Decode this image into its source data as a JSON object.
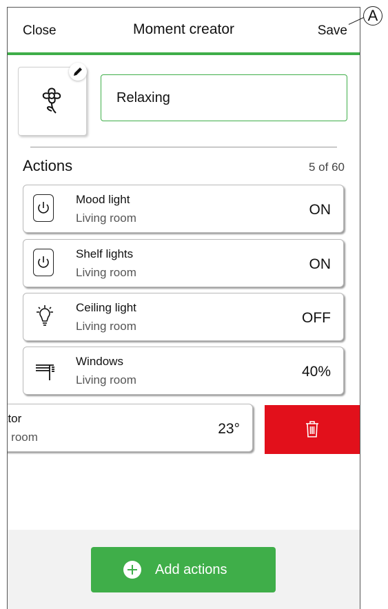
{
  "header": {
    "close_label": "Close",
    "title": "Moment creator",
    "save_label": "Save"
  },
  "callout": {
    "label": "A"
  },
  "moment": {
    "icon": "flower-icon",
    "name": "Relaxing"
  },
  "actions": {
    "title": "Actions",
    "count": "5 of 60",
    "items": [
      {
        "icon": "power-icon",
        "name": "Mood light",
        "room": "Living room",
        "value": "ON"
      },
      {
        "icon": "power-icon",
        "name": "Shelf lights",
        "room": "Living room",
        "value": "ON"
      },
      {
        "icon": "bulb-icon",
        "name": "Ceiling light",
        "room": "Living room",
        "value": "OFF"
      },
      {
        "icon": "shutter-icon",
        "name": "Windows",
        "room": "Living room",
        "value": "40%"
      },
      {
        "icon": "thermostat-icon",
        "name": "ator",
        "room": "g room",
        "value": "23°"
      }
    ]
  },
  "delete": {
    "icon": "trash-icon"
  },
  "footer": {
    "add_label": "Add actions"
  },
  "colors": {
    "accent": "#3fae49",
    "danger": "#e2101b"
  }
}
